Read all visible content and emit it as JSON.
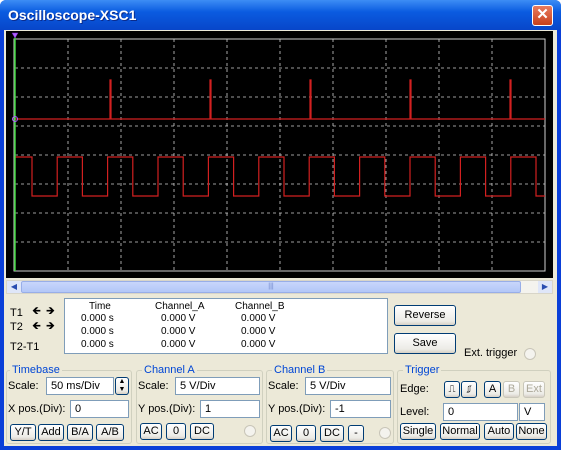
{
  "window": {
    "title": "Oscilloscope-XSC1",
    "close_label": "✕"
  },
  "readout": {
    "headers": [
      "Time",
      "Channel_A",
      "Channel_B"
    ],
    "rows": [
      {
        "label": "T1",
        "time": "0.000 s",
        "a": "0.000 V",
        "b": "0.000 V"
      },
      {
        "label": "T2",
        "time": "0.000 s",
        "a": "0.000 V",
        "b": "0.000 V"
      },
      {
        "label": "T2-T1",
        "time": "0.000 s",
        "a": "0.000 V",
        "b": "0.000 V"
      }
    ]
  },
  "buttons": {
    "reverse": "Reverse",
    "save": "Save",
    "ext_trigger": "Ext. trigger"
  },
  "timebase": {
    "title": "Timebase",
    "scale_label": "Scale:",
    "scale_value": "50 ms/Div",
    "xpos_label": "X pos.(Div):",
    "xpos_value": "0",
    "modes": [
      "Y/T",
      "Add",
      "B/A",
      "A/B"
    ]
  },
  "channel_a": {
    "title": "Channel A",
    "scale_label": "Scale:",
    "scale_value": "5  V/Div",
    "ypos_label": "Y pos.(Div):",
    "ypos_value": "1",
    "coupling": [
      "AC",
      "0",
      "DC"
    ]
  },
  "channel_b": {
    "title": "Channel B",
    "scale_label": "Scale:",
    "scale_value": "5  V/Div",
    "ypos_label": "Y pos.(Div):",
    "ypos_value": "-1",
    "coupling": [
      "AC",
      "0",
      "DC",
      "-"
    ]
  },
  "trigger": {
    "title": "Trigger",
    "edge_label": "Edge:",
    "edge_buttons": [
      "A",
      "B",
      "Ext"
    ],
    "level_label": "Level:",
    "level_value": "0",
    "level_unit": "V",
    "modes": [
      "Single",
      "Normal",
      "Auto",
      "None"
    ]
  },
  "scope": {
    "colors": {
      "trace": "#d22020",
      "grid": "#cfcfcf",
      "background": "#000000",
      "cursor": "#3cd23c"
    },
    "scrollbar_grip": "|||"
  }
}
